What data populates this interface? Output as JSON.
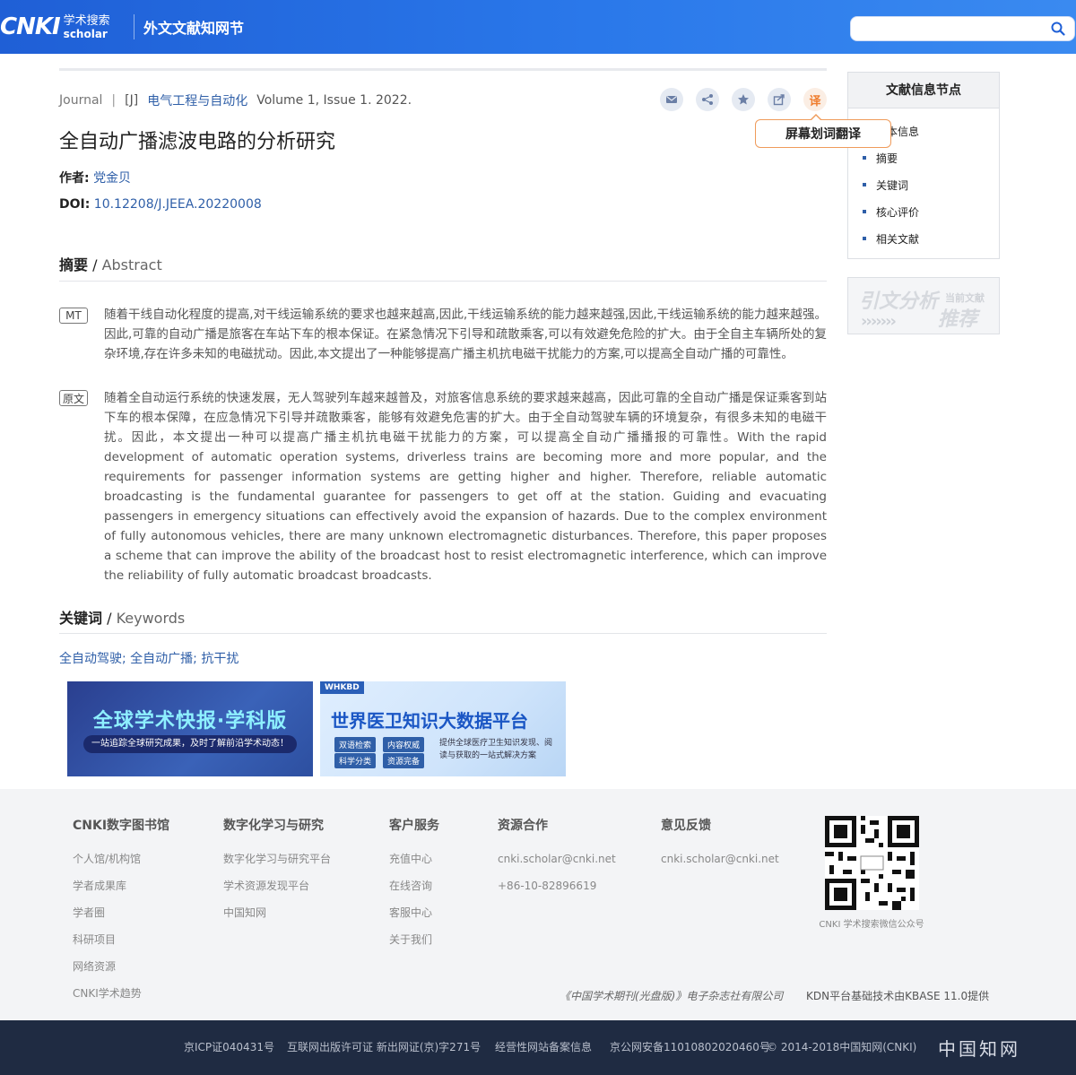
{
  "header": {
    "logo_main": "CNKI",
    "logo_cn": "学术搜索",
    "logo_en": "scholar",
    "site_title": "外文文献知网节",
    "search_value": ""
  },
  "meta": {
    "type": "Journal",
    "sep": "|",
    "jtype": "[J]",
    "journal": "电气工程与自动化",
    "volume": "Volume 1, Issue 1. 2022."
  },
  "actions": {
    "translate_label": "译",
    "tooltip": "屏幕划词翻译"
  },
  "article": {
    "title": "全自动广播滤波电路的分析研究",
    "author_label": "作者:",
    "author": "党金贝",
    "doi_label": "DOI:",
    "doi": "10.12208/J.JEEA.20220008"
  },
  "abstract": {
    "head_cn": "摘要",
    "head_sep": " / ",
    "head_en": "Abstract",
    "mt_tag": "MT",
    "mt_text": "随着干线自动化程度的提高,对干线运输系统的要求也越来越高,因此,干线运输系统的能力越来越强,因此,干线运输系统的能力越来越强。因此,可靠的自动广播是旅客在车站下车的根本保证。在紧急情况下引导和疏散乘客,可以有效避免危险的扩大。由于全自主车辆所处的复杂环境,存在许多未知的电磁扰动。因此,本文提出了一种能够提高广播主机抗电磁干扰能力的方案,可以提高全自动广播的可靠性。",
    "orig_tag": "原文",
    "orig_text": "随着全自动运行系统的快速发展，无人驾驶列车越来越普及，对旅客信息系统的要求越来越高，因此可靠的全自动广播是保证乘客到站下车的根本保障，在应急情况下引导并疏散乘客，能够有效避免危害的扩大。由于全自动驾驶车辆的环境复杂，有很多未知的电磁干扰。因此，本文提出一种可以提高广播主机抗电磁干扰能力的方案，可以提高全自动广播播报的可靠性。With the rapid development of automatic operation systems, driverless trains are becoming more and more popular, and the requirements for passenger information systems are getting higher and higher. Therefore, reliable automatic broadcasting is the fundamental guarantee for passengers to get off at the station. Guiding and evacuating passengers in emergency situations can effectively avoid the expansion of hazards. Due to the complex environment of fully autonomous vehicles, there are many unknown electromagnetic disturbances. Therefore, this paper proposes a scheme that can improve the ability of the broadcast host to resist electromagnetic interference, which can improve the reliability of fully automatic broadcast broadcasts."
  },
  "keywords": {
    "head_cn": "关键词",
    "head_sep": " / ",
    "head_en": "Keywords",
    "list": "全自动驾驶; 全自动广播; 抗干扰"
  },
  "banners": {
    "b1_title": "全球学术快报·学科版",
    "b1_sub": "一站追踪全球研究成果，及时了解前沿学术动态！",
    "b2_badge": "WHKBD",
    "b2_title": "世界医卫知识大数据平台",
    "b2_chips": [
      "双语检索",
      "内容权威",
      "科学分类",
      "资源完备"
    ],
    "b2_desc": "提供全球医疗卫生知识发现、阅读与获取的一站式解决方案"
  },
  "sidebar": {
    "head": "文献信息节点",
    "items": [
      "基本信息",
      "摘要",
      "关键词",
      "核心评价",
      "相关文献"
    ],
    "cite_a": "引文分析",
    "cite_b": "当前文献",
    "cite_c": "推荐",
    "cite_arrows": "›››››››"
  },
  "footer": {
    "cols": [
      {
        "head": "CNKI数字图书馆",
        "links": [
          "个人馆/机构馆",
          "学者成果库",
          "学者圈",
          "科研项目",
          "网络资源",
          "CNKI学术趋势"
        ]
      },
      {
        "head": "数字化学习与研究",
        "links": [
          "数字化学习与研究平台",
          "学术资源发现平台",
          "中国知网"
        ]
      },
      {
        "head": "客户服务",
        "links": [
          "充值中心",
          "在线咨询",
          "客服中心",
          "关于我们"
        ]
      },
      {
        "head": "资源合作",
        "links": [
          "cnki.scholar@cnki.net",
          "+86-10-82896619"
        ]
      },
      {
        "head": "意见反馈",
        "links": [
          "cnki.scholar@cnki.net"
        ]
      }
    ],
    "qr_caption": "CNKI 学术搜索微信公众号",
    "corp": "《中国学术期刊(光盘版)》电子杂志社有限公司",
    "kdn": "KDN平台基础技术由KBASE 11.0提供"
  },
  "bottom": {
    "icp": "京ICP证040431号",
    "pub": "互联网出版许可证 新出网证(京)字271号",
    "biz": "经营性网站备案信息",
    "police": "京公网安备11010802020460号",
    "copy": "© 2014-2018中国知网(CNKI)",
    "logo": "中国知网"
  }
}
